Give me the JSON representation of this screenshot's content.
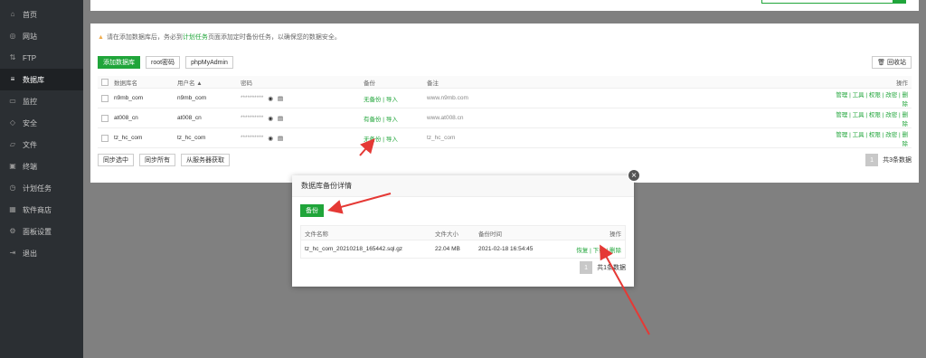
{
  "sidebar": {
    "items": [
      {
        "label": "首页",
        "icon": "home-icon",
        "glyph": "⌂",
        "active": false
      },
      {
        "label": "网站",
        "icon": "globe-icon",
        "glyph": "◎",
        "active": false
      },
      {
        "label": "FTP",
        "icon": "ftp-icon",
        "glyph": "⇅",
        "active": false
      },
      {
        "label": "数据库",
        "icon": "database-icon",
        "glyph": "≡",
        "active": true
      },
      {
        "label": "监控",
        "icon": "monitor-icon",
        "glyph": "▭",
        "active": false
      },
      {
        "label": "安全",
        "icon": "shield-icon",
        "glyph": "◇",
        "active": false
      },
      {
        "label": "文件",
        "icon": "folder-icon",
        "glyph": "▱",
        "active": false
      },
      {
        "label": "终端",
        "icon": "terminal-icon",
        "glyph": "▣",
        "active": false
      },
      {
        "label": "计划任务",
        "icon": "clock-icon",
        "glyph": "◷",
        "active": false
      },
      {
        "label": "软件商店",
        "icon": "grid-icon",
        "glyph": "▦",
        "active": false
      },
      {
        "label": "面板设置",
        "icon": "gear-icon",
        "glyph": "⚙",
        "active": false
      },
      {
        "label": "退出",
        "icon": "logout-icon",
        "glyph": "⇥",
        "active": false
      }
    ]
  },
  "notice": {
    "prefix": "请在添加数据库后，务必到",
    "link": "计划任务",
    "suffix": "页面添加定时备份任务，以确保您的数据安全。"
  },
  "toolbar": {
    "add_db": "添加数据库",
    "root_pass": "root密码",
    "phpmyadmin": "phpMyAdmin",
    "recycle": "回收站"
  },
  "table": {
    "headers": {
      "name": "数据库名",
      "user": "用户名 ▲",
      "pass": "密码",
      "backup": "备份",
      "note": "备注",
      "ops": "操作"
    },
    "rows": [
      {
        "name": "n9mb_com",
        "user": "n9mb_com",
        "pass": "**********",
        "backup": "无备份",
        "import": "导入",
        "note": "www.n9mb.com",
        "ops": "管理 | 工具 | 权限 | 改密 | 删除"
      },
      {
        "name": "at008_cn",
        "user": "at008_cn",
        "pass": "**********",
        "backup": "有备份",
        "import": "导入",
        "note": "www.at008.cn",
        "ops": "管理 | 工具 | 权限 | 改密 | 删除"
      },
      {
        "name": "tz_hc_com",
        "user": "tz_hc_com",
        "pass": "**********",
        "backup": "无备份",
        "import": "导入",
        "note": "tz_hc_com",
        "ops": "管理 | 工具 | 权限 | 改密 | 删除"
      }
    ]
  },
  "bottom": {
    "sync_selected": "同步选中",
    "sync_all": "同步所有",
    "from_server": "从服务器获取",
    "page": "1",
    "total": "共3条数据"
  },
  "modal": {
    "title": "数据库备份详情",
    "backup_button": "备份",
    "headers": {
      "file": "文件名称",
      "size": "文件大小",
      "time": "备份时间",
      "ops": "操作"
    },
    "rows": [
      {
        "file": "tz_hc_com_20210218_165442.sql.gz",
        "size": "22.04 MB",
        "time": "2021-02-18 16:54:45",
        "restore": "恢复",
        "download": "下载",
        "delete": "删除"
      }
    ],
    "page": "1",
    "total": "共1条数据"
  },
  "colors": {
    "accent": "#20a53a",
    "annotation": "#e53935"
  }
}
